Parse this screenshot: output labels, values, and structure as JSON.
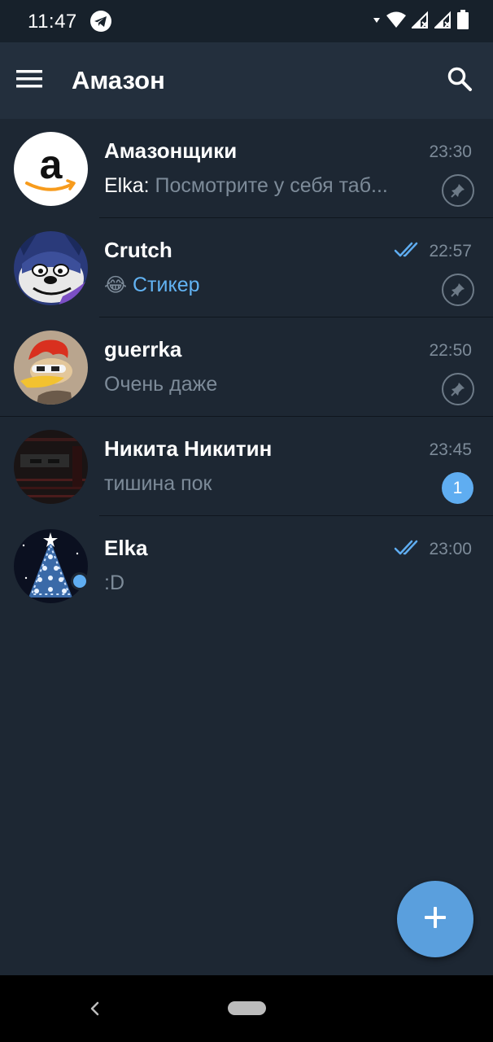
{
  "status_bar": {
    "time": "11:47",
    "icons": [
      "telegram-status-icon",
      "wifi-icon",
      "signal-icon",
      "signal-icon",
      "battery-icon"
    ]
  },
  "app_bar": {
    "title": "Амазон",
    "menu_icon": "hamburger-menu-icon",
    "search_icon": "search-icon"
  },
  "chats": [
    {
      "name": "Амазонщики",
      "time": "23:30",
      "sender": "Elka:",
      "preview": "Посмотрите у себя таб...",
      "pinned": true,
      "avatar": "amazon-logo"
    },
    {
      "name": "Crutch",
      "time": "22:57",
      "preview_emoji": "😂",
      "preview_media": "Стикер",
      "read": true,
      "pinned": true,
      "avatar": "cartoon-cat"
    },
    {
      "name": "guerrka",
      "time": "22:50",
      "preview": "Очень даже",
      "pinned": true,
      "avatar": "woodpecker"
    },
    {
      "name": "Никита Никитин",
      "time": "23:45",
      "preview": "тишина пок",
      "unread": "1",
      "avatar": "dark-photo"
    },
    {
      "name": "Elka",
      "time": "23:00",
      "preview": ":D",
      "read": true,
      "online": true,
      "avatar": "christmas-tree"
    }
  ],
  "fab": {
    "icon": "plus-icon"
  },
  "colors": {
    "background": "#1d2733",
    "app_bar": "#232f3d",
    "accent": "#5fadf1",
    "secondary_text": "#7d8b99"
  }
}
